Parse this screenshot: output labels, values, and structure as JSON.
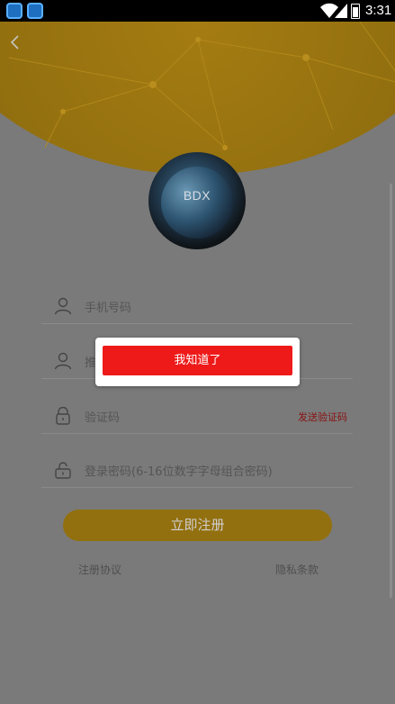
{
  "status_bar": {
    "time": "3:31",
    "notification_icons": [
      "app-icon",
      "app-icon"
    ]
  },
  "header": {
    "back_icon": "chevron-left-icon",
    "logo_text": "BDX"
  },
  "form": {
    "phone_placeholder": "手机号码",
    "referrer_placeholder": "推",
    "code_placeholder": "验证码",
    "send_code_label": "发送验证码",
    "password_placeholder": "登录密码(6-16位数字字母组合密码)"
  },
  "actions": {
    "register_label": "立即注册",
    "agreement_label": "注册协议",
    "privacy_label": "隐私条款"
  },
  "dialog": {
    "confirm_label": "我知道了"
  },
  "colors": {
    "header_gold": "#e8b41a",
    "dialog_button": "#ee1a1a",
    "send_code_text": "#c0231e",
    "overlay": "#777777"
  }
}
